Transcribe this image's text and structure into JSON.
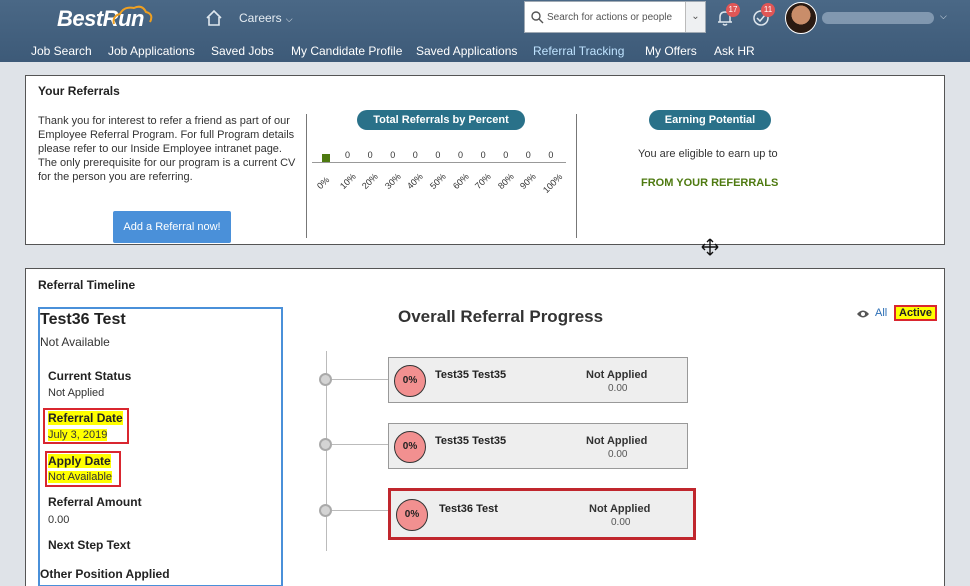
{
  "header": {
    "logo": "BestRun",
    "careers": "Careers",
    "search_placeholder": "Search for actions or people",
    "notifications_count": "17",
    "tasks_count": "11"
  },
  "nav": {
    "items": [
      {
        "label": "Job Search"
      },
      {
        "label": "Job Applications"
      },
      {
        "label": "Saved Jobs"
      },
      {
        "label": "My Candidate Profile"
      },
      {
        "label": "Saved Applications"
      },
      {
        "label": "Referral Tracking"
      },
      {
        "label": "My Offers"
      },
      {
        "label": "Ask HR"
      }
    ],
    "active_index": 5
  },
  "referrals": {
    "title": "Your Referrals",
    "intro": "Thank you for interest to refer a friend as part of our Employee Referral Program. For full Program details please refer to our Inside Employee intranet page. The only prerequisite for our program is a current CV for the person you are referring.",
    "add_button": "Add a Referral now!",
    "percent_title": "Total Referrals by Percent",
    "percent_values": [
      "0",
      "0",
      "0",
      "0",
      "0",
      "0",
      "0",
      "0",
      "0",
      "0"
    ],
    "percent_labels": [
      "0%",
      "10%",
      "20%",
      "30%",
      "40%",
      "50%",
      "60%",
      "70%",
      "80%",
      "90%",
      "100%"
    ],
    "earning_title": "Earning Potential",
    "earning_text": "You are eligible to earn up to",
    "earning_green": "FROM YOUR REFERRALS"
  },
  "timeline": {
    "title": "Referral Timeline",
    "candidate": {
      "name": "Test36 Test",
      "subtitle": "Not Available",
      "current_status_label": "Current Status",
      "current_status_value": "Not Applied",
      "referral_date_label": "Referral Date",
      "referral_date_value": "July 3, 2019",
      "apply_date_label": "Apply Date",
      "apply_date_value": "Not Available",
      "referral_amount_label": "Referral Amount",
      "referral_amount_value": "0.00",
      "next_step_label": "Next Step Text",
      "other_position_label": "Other Position Applied"
    },
    "overall_title": "Overall Referral Progress",
    "filter_all": "All",
    "filter_active": "Active",
    "cards": [
      {
        "pct": "0%",
        "name": "Test35 Test35",
        "status": "Not Applied",
        "amount": "0.00"
      },
      {
        "pct": "0%",
        "name": "Test35 Test35",
        "status": "Not Applied",
        "amount": "0.00"
      },
      {
        "pct": "0%",
        "name": "Test36 Test",
        "status": "Not Applied",
        "amount": "0.00"
      }
    ]
  }
}
